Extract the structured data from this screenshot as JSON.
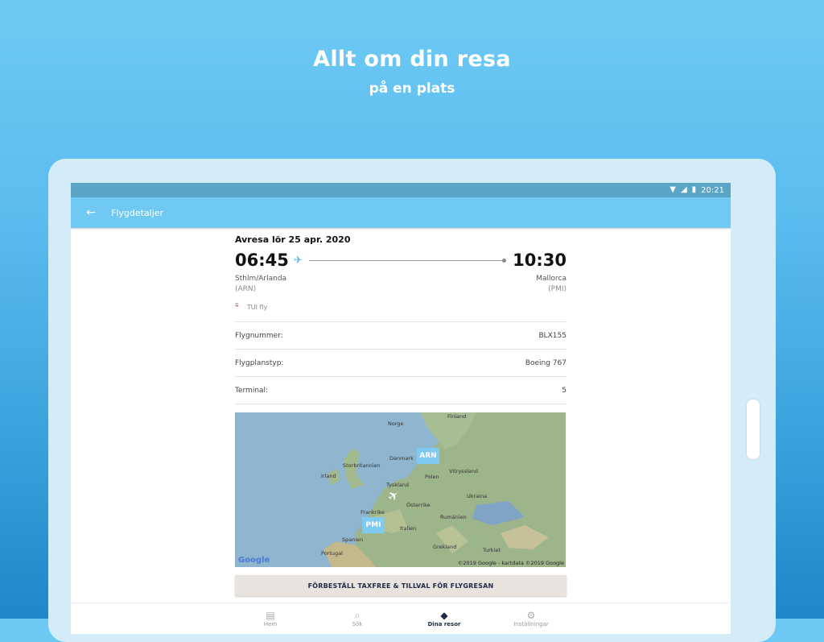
{
  "hero": {
    "title": "Allt om din resa",
    "subtitle": "på en plats"
  },
  "statusbar": {
    "time": "20:21",
    "wifi_icon": "wifi-icon",
    "signal_icon": "signal-icon",
    "battery_icon": "battery-icon"
  },
  "appbar": {
    "back_icon": "←",
    "title": "Flygdetaljer"
  },
  "flight": {
    "departure_date": "Avresa lör 25 apr. 2020",
    "dep_time": "06:45",
    "arr_time": "10:30",
    "plane_icon": "✈",
    "dep_city": "Sthlm/Arlanda",
    "dep_code": "(ARN)",
    "arr_city": "Mallorca",
    "arr_code": "(PMI)",
    "airline_logo": "ᵕ̈",
    "airline": "TUI fly"
  },
  "details": [
    {
      "label": "Flygnummer:",
      "value": "BLX155"
    },
    {
      "label": "Flygplanstyp:",
      "value": "Boeing 767"
    },
    {
      "label": "Terminal:",
      "value": "5"
    }
  ],
  "map": {
    "labels": {
      "finland": "Finland",
      "norge": "Norge",
      "danmark": "Danmark",
      "storbritannien": "Storbritannien",
      "irland": "Irland",
      "vitryssland": "Vitryssland",
      "polen": "Polen",
      "tyskland": "Tyskland",
      "ukraina": "Ukraina",
      "frankrike": "Frankrike",
      "osterrike": "Österrike",
      "rumanien": "Rumänien",
      "spanien": "Spanien",
      "italien": "Italien",
      "grekland": "Grekland",
      "turkiet": "Turkiet",
      "portugal": "Portugal"
    },
    "pin_arn": "ARN",
    "pin_pmi": "PMI",
    "google": "Google",
    "attribution": "©2019 Google - kartdata ©2019 Google"
  },
  "cta": "FÖRBESTÄLL TAXFREE & TILLVAL FÖR FLYGRESAN",
  "nav": {
    "home": "Hem",
    "search": "Sök",
    "trips": "Dina resor",
    "settings": "Inställningar"
  },
  "colors": {
    "accent": "#6fc9f2",
    "status": "#5aa5c6",
    "tui_red": "#d8262d",
    "nav_active": "#1d2a44"
  }
}
